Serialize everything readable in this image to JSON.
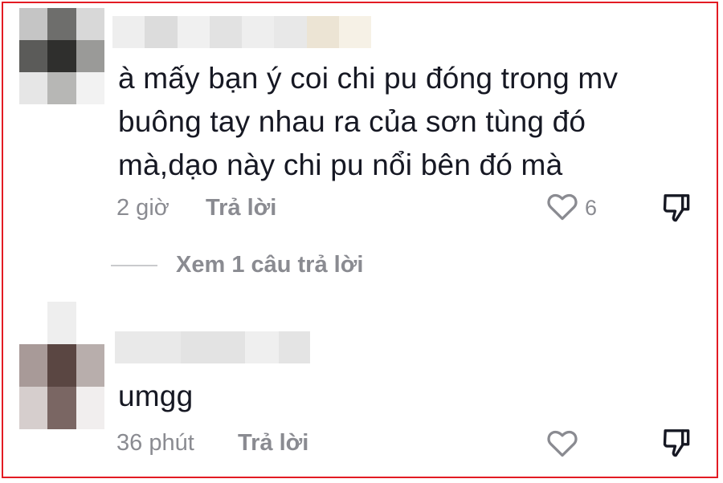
{
  "comments": [
    {
      "text_lines": [
        "à mấy bạn ý coi chi pu đóng trong mv",
        "buông tay nhau ra của sơn tùng đó",
        "mà,dạo này chi pu nổi bên đó mà"
      ],
      "time": "2 giờ",
      "reply_label": "Trả lời",
      "like_count": "6"
    },
    {
      "text_lines": [
        "umgg"
      ],
      "time": "36 phút",
      "reply_label": "Trả lời",
      "like_count": ""
    }
  ],
  "view_replies_label": "Xem 1 câu trả lời",
  "colors": {
    "frame": "#e31b23",
    "text": "#161823",
    "secondary": "#8a8b91"
  },
  "icons": [
    "heart-icon",
    "dislike-icon"
  ]
}
